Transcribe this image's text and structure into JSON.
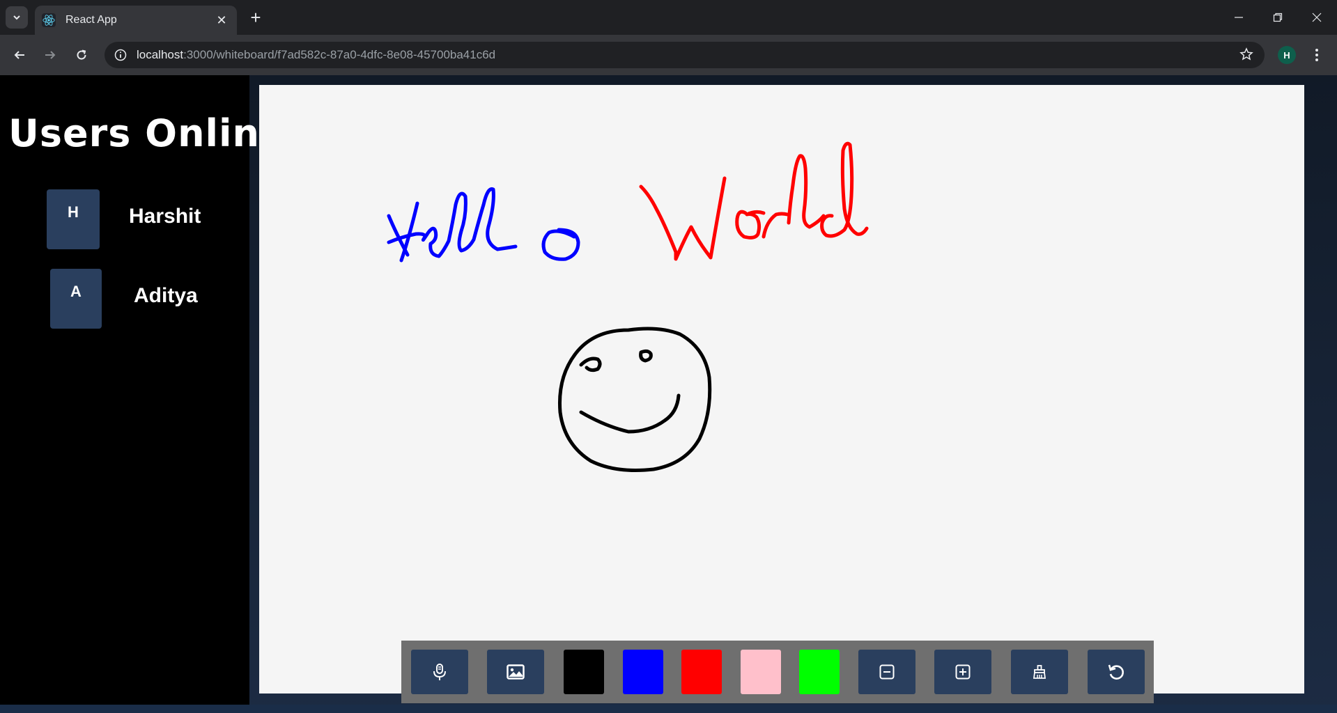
{
  "browser": {
    "tab_title": "React App",
    "url_host": "localhost",
    "url_rest": ":3000/whiteboard/f7ad582c-87a0-4dfc-8e08-45700ba41c6d",
    "profile_initial": "H"
  },
  "sidebar": {
    "title": "Users Online:",
    "users": [
      {
        "initial": "H",
        "name": "Harshit"
      },
      {
        "initial": "A",
        "name": "Aditya"
      }
    ]
  },
  "canvas": {
    "drawings": [
      {
        "name": "hello-text",
        "color": "#0000ff"
      },
      {
        "name": "world-text",
        "color": "#ff0000"
      },
      {
        "name": "smiley-face",
        "color": "#000000"
      }
    ]
  },
  "toolbox": {
    "tools": [
      "microphone-icon",
      "image-icon",
      "zoom-out-icon",
      "zoom-in-icon",
      "broom-icon",
      "undo-icon"
    ],
    "colors": [
      "#000000",
      "#0000ff",
      "#ff0000",
      "#ffc0cb",
      "#00ff00"
    ]
  }
}
